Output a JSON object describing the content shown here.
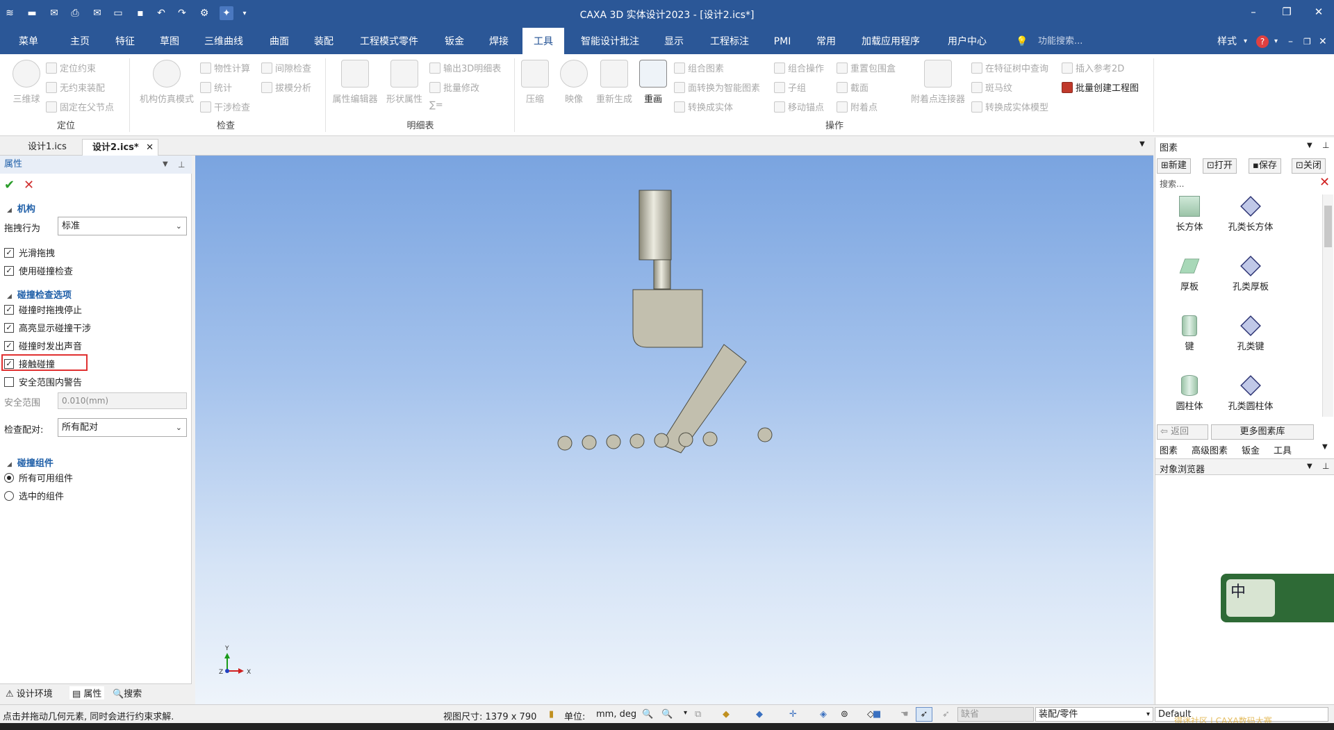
{
  "window": {
    "title": "CAXA 3D 实体设计2023 - [设计2.ics*]"
  },
  "quick_access": {
    "icons": [
      "app-icon",
      "new-icon",
      "open-icon",
      "mail-icon",
      "print-icon",
      "email-icon",
      "folder-icon",
      "save-icon",
      "undo-icon",
      "redo-icon",
      "gear-icon",
      "star-icon",
      "dropdown-icon"
    ]
  },
  "menu": {
    "items": [
      "菜单",
      "主页",
      "特征",
      "草图",
      "三维曲线",
      "曲面",
      "装配",
      "工程模式零件",
      "钣金",
      "焊接",
      "工具",
      "智能设计批注",
      "显示",
      "工程标注",
      "PMI",
      "常用",
      "加载应用程序",
      "用户中心"
    ],
    "active": "工具",
    "search_placeholder": "功能搜索...",
    "style_label": "样式"
  },
  "ribbon": {
    "groups": {
      "locate": "定位",
      "check": "检查",
      "detail": "明细表",
      "operate": "操作"
    },
    "big_buttons": {
      "sphere": "三维球",
      "mechanism": "机构仿真模式",
      "attr_editor": "属性编辑器",
      "shape_attr": "形状属性",
      "compress": "压缩",
      "mirror": "映像",
      "regen": "重新生成",
      "redraw": "重画",
      "attach_connector": "附着点连接器"
    },
    "small_buttons": {
      "locate_constraint": "定位约束",
      "free_assembly": "无约束装配",
      "fix_parent": "固定在父节点",
      "property_calc": "物性计算",
      "statistics": "统计",
      "interference": "干涉检查",
      "gap_check": "间隙检查",
      "draft_analysis": "拔模分析",
      "export_bom": "输出3D明细表",
      "batch_modify": "批量修改",
      "sum": "∑=",
      "combine_elements": "组合图素",
      "face_to_smart": "面转换为智能图素",
      "convert_solid": "转换成实体",
      "combine_op": "组合操作",
      "subgroup": "子组",
      "move_anchor": "移动锚点",
      "reset_bbox": "重置包围盒",
      "section": "截面",
      "attach_point": "附着点",
      "find_in_tree": "在特征树中查询",
      "zebra": "斑马纹",
      "to_solid_model": "转换成实体模型",
      "insert_ref2d": "插入参考2D",
      "batch_drawing": "批量创建工程图"
    }
  },
  "doc_tabs": [
    "设计1.ics",
    "设计2.ics*"
  ],
  "left_panel": {
    "title": "属性",
    "section_mechanism": "机构",
    "drag_behavior_label": "拖拽行为",
    "drag_behavior_value": "标准",
    "smooth_drag": "光滑拖拽",
    "use_collision": "使用碰撞检查",
    "section_collision_opts": "碰撞检查选项",
    "stop_on_collision": "碰撞时拖拽停止",
    "highlight_collision": "高亮显示碰撞干涉",
    "sound_on_collision": "碰撞时发出声音",
    "contact_collision": "接触碰撞",
    "safe_range_warning": "安全范围内警告",
    "safe_range_label": "安全范围",
    "safe_range_value": "0.010(mm)",
    "check_pair_label": "检查配对:",
    "check_pair_value": "所有配对",
    "section_components": "碰撞组件",
    "all_components": "所有可用组件",
    "selected_components": "选中的组件",
    "bottom_tabs": [
      "设计环境",
      "属性",
      "搜索"
    ]
  },
  "right_panel": {
    "title": "图素",
    "buttons": [
      "新建",
      "打开",
      "保存",
      "关闭"
    ],
    "search_placeholder": "搜索...",
    "items": [
      "长方体",
      "孔类长方体",
      "厚板",
      "孔类厚板",
      "键",
      "孔类键",
      "圆柱体",
      "孔类圆柱体"
    ],
    "back_label": "返回",
    "more_label": "更多图素库",
    "tabs": [
      "图素",
      "高级图素",
      "钣金",
      "工具"
    ],
    "object_browser": "对象浏览器",
    "ime_label": "中"
  },
  "status_bar": {
    "hint": "点击并拖动几何元素, 同时会进行约束求解.",
    "view_size": "视图尺寸: 1379 x  790",
    "unit_label": "单位:",
    "unit_value": "mm, deg",
    "filter_value": "缺省",
    "mode_value": "装配/零件",
    "default_value": "Default",
    "watermark": "得迷社区  |  CAXA数码大赛"
  },
  "colors": {
    "title_bar": "#2b5797",
    "part_fill": "#c2bfae",
    "part_stroke": "#4a4a40",
    "highlight_box": "#e03030"
  }
}
